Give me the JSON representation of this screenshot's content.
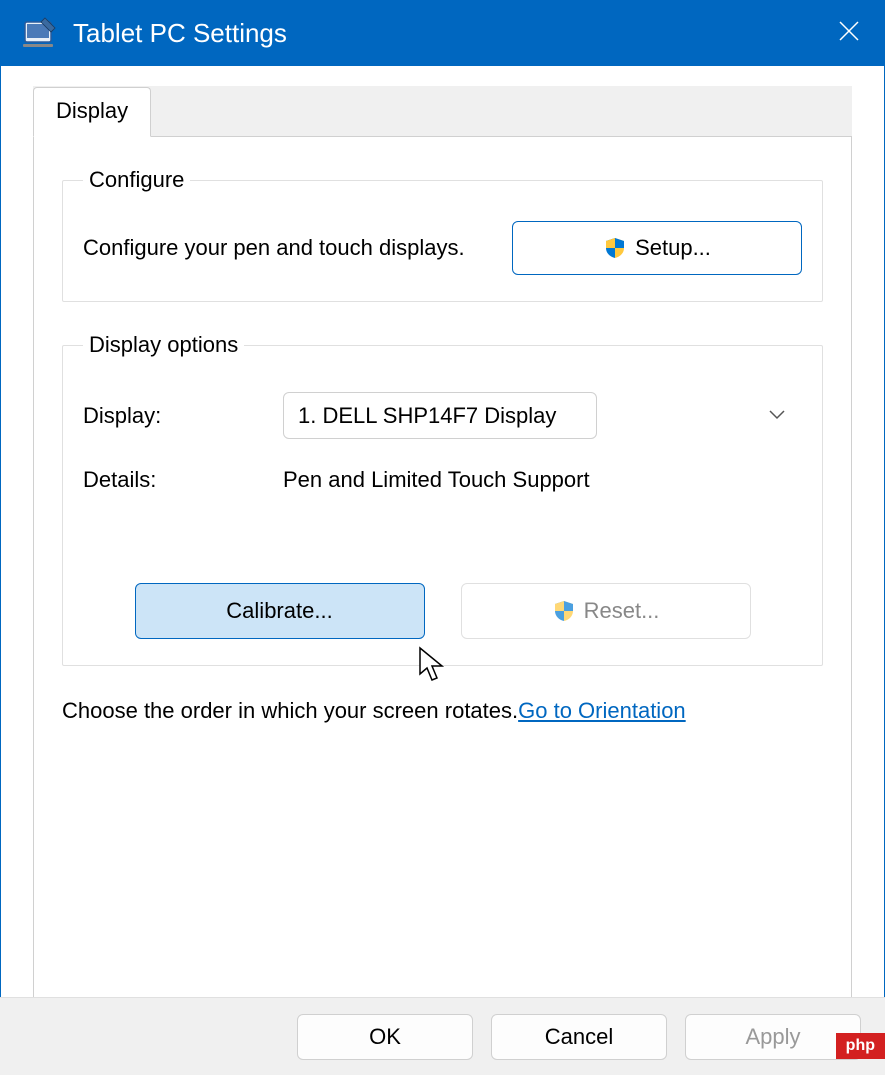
{
  "titlebar": {
    "title": "Tablet PC Settings"
  },
  "tabs": {
    "display_label": "Display"
  },
  "configure": {
    "legend": "Configure",
    "text": "Configure your pen and touch displays.",
    "setup_label": "Setup..."
  },
  "display_options": {
    "legend": "Display options",
    "display_label": "Display:",
    "display_value": "1. DELL SHP14F7 Display",
    "details_label": "Details:",
    "details_value": "Pen and Limited Touch Support",
    "calibrate_label": "Calibrate...",
    "reset_label": "Reset..."
  },
  "rotate": {
    "text": "Choose the order in which your screen rotates.",
    "link": "Go to Orientation"
  },
  "dialog": {
    "ok": "OK",
    "cancel": "Cancel",
    "apply": "Apply"
  },
  "watermark": "php"
}
